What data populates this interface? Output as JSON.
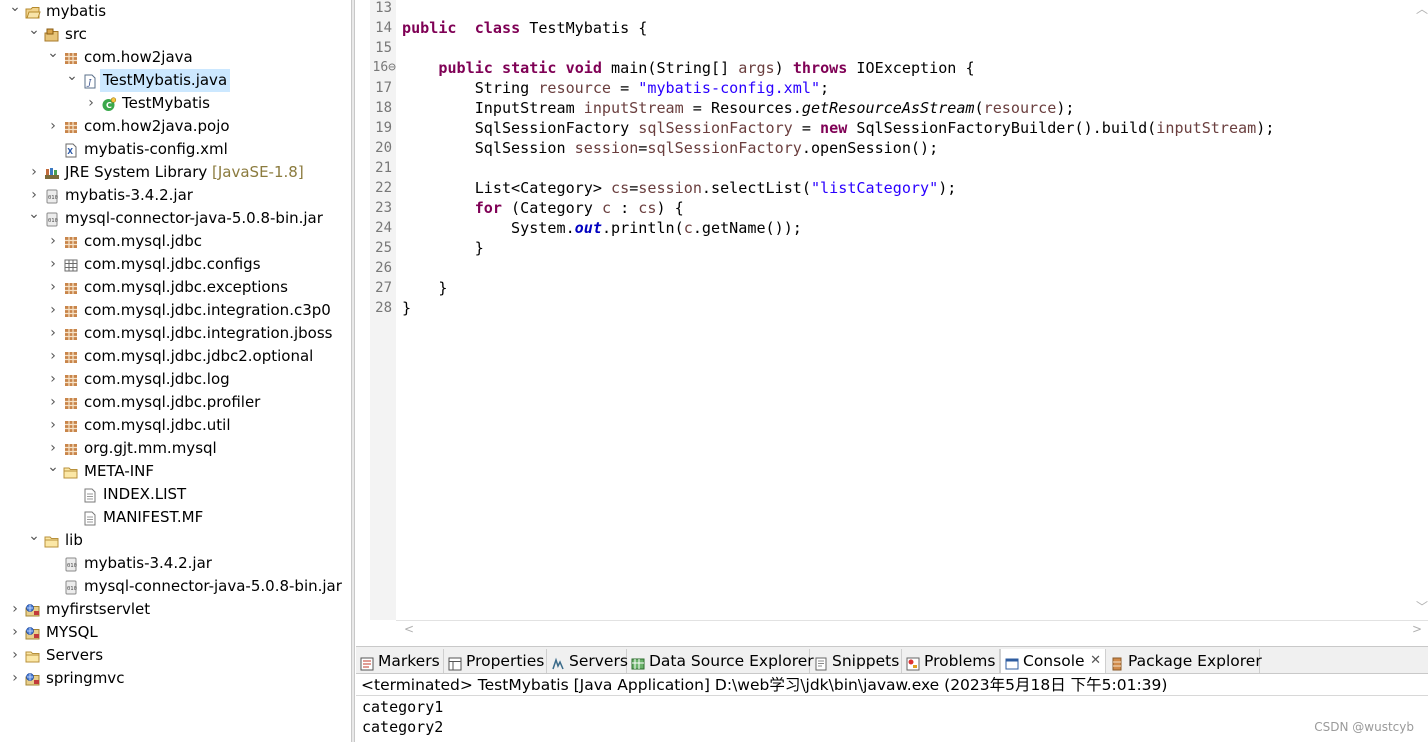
{
  "tree": {
    "items": [
      {
        "label": "mybatis",
        "icon": "project-folder-icon",
        "twisty": "expanded"
      },
      {
        "label": "src",
        "icon": "source-folder-icon",
        "twisty": "expanded"
      },
      {
        "label": "com.how2java",
        "icon": "package-icon",
        "twisty": "expanded"
      },
      {
        "label": "TestMybatis.java",
        "icon": "java-file-icon",
        "twisty": "expanded"
      },
      {
        "label": "TestMybatis",
        "icon": "class-icon",
        "twisty": "collapsed"
      },
      {
        "label": "com.how2java.pojo",
        "icon": "package-icon",
        "twisty": "collapsed"
      },
      {
        "label": "mybatis-config.xml",
        "icon": "xml-file-icon",
        "twisty": "none"
      },
      {
        "label": "JRE System Library",
        "hint": "[JavaSE-1.8]",
        "icon": "library-icon",
        "twisty": "collapsed"
      },
      {
        "label": "mybatis-3.4.2.jar",
        "icon": "jar-icon",
        "twisty": "collapsed"
      },
      {
        "label": "mysql-connector-java-5.0.8-bin.jar",
        "icon": "jar-icon",
        "twisty": "expanded"
      },
      {
        "label": "com.mysql.jdbc",
        "icon": "package-icon",
        "twisty": "collapsed"
      },
      {
        "label": "com.mysql.jdbc.configs",
        "icon": "empty-package-icon",
        "twisty": "collapsed"
      },
      {
        "label": "com.mysql.jdbc.exceptions",
        "icon": "package-icon",
        "twisty": "collapsed"
      },
      {
        "label": "com.mysql.jdbc.integration.c3p0",
        "icon": "package-icon",
        "twisty": "collapsed"
      },
      {
        "label": "com.mysql.jdbc.integration.jboss",
        "icon": "package-icon",
        "twisty": "collapsed"
      },
      {
        "label": "com.mysql.jdbc.jdbc2.optional",
        "icon": "package-icon",
        "twisty": "collapsed"
      },
      {
        "label": "com.mysql.jdbc.log",
        "icon": "package-icon",
        "twisty": "collapsed"
      },
      {
        "label": "com.mysql.jdbc.profiler",
        "icon": "package-icon",
        "twisty": "collapsed"
      },
      {
        "label": "com.mysql.jdbc.util",
        "icon": "package-icon",
        "twisty": "collapsed"
      },
      {
        "label": "org.gjt.mm.mysql",
        "icon": "package-icon",
        "twisty": "collapsed"
      },
      {
        "label": "META-INF",
        "icon": "folder-icon",
        "twisty": "expanded"
      },
      {
        "label": "INDEX.LIST",
        "icon": "text-file-icon",
        "twisty": "none"
      },
      {
        "label": "MANIFEST.MF",
        "icon": "text-file-icon",
        "twisty": "none"
      },
      {
        "label": "lib",
        "icon": "folder-icon",
        "twisty": "expanded"
      },
      {
        "label": "mybatis-3.4.2.jar",
        "icon": "jar-icon",
        "twisty": "none"
      },
      {
        "label": "mysql-connector-java-5.0.8-bin.jar",
        "icon": "jar-icon",
        "twisty": "none"
      },
      {
        "label": "myfirstservlet",
        "icon": "web-project-icon",
        "twisty": "collapsed"
      },
      {
        "label": "MYSQL",
        "icon": "web-project-icon",
        "twisty": "collapsed"
      },
      {
        "label": "Servers",
        "icon": "folder-icon",
        "twisty": "collapsed"
      },
      {
        "label": "springmvc",
        "icon": "web-project-icon",
        "twisty": "collapsed"
      }
    ]
  },
  "editor": {
    "lines": [
      {
        "n": "13"
      },
      {
        "n": "14",
        "parts": [
          [
            "kw",
            "public"
          ],
          [
            "",
            "  "
          ],
          [
            "kw",
            "class"
          ],
          [
            "",
            " TestMybatis {"
          ]
        ]
      },
      {
        "n": "15",
        "parts": []
      },
      {
        "n": "16⊖",
        "parts": [
          [
            "",
            "    "
          ],
          [
            "kw",
            "public"
          ],
          [
            "",
            ""
          ],
          [
            "kw",
            " static"
          ],
          [
            "kw",
            " void"
          ],
          [
            "",
            " main(String[] "
          ],
          [
            "fld",
            "args"
          ],
          [
            "",
            ") "
          ],
          [
            "kw",
            "throws"
          ],
          [
            "",
            " IOException {"
          ]
        ]
      },
      {
        "n": "17",
        "parts": [
          [
            "",
            "        String "
          ],
          [
            "fld",
            "resource"
          ],
          [
            "",
            " = "
          ],
          [
            "str",
            "\"mybatis-config.xml\""
          ],
          [
            "",
            ";"
          ]
        ]
      },
      {
        "n": "18",
        "parts": [
          [
            "",
            "        InputStream "
          ],
          [
            "fld",
            "inputStream"
          ],
          [
            "",
            " = Resources."
          ],
          [
            "it",
            "getResourceAsStream"
          ],
          [
            "",
            "("
          ],
          [
            "fld",
            "resource"
          ],
          [
            "",
            ");"
          ]
        ]
      },
      {
        "n": "19",
        "parts": [
          [
            "",
            "        SqlSessionFactory "
          ],
          [
            "fld",
            "sqlSessionFactory"
          ],
          [
            "",
            " = "
          ],
          [
            "kw",
            "new"
          ],
          [
            "",
            " SqlSessionFactoryBuilder().build("
          ],
          [
            "fld",
            "inputStream"
          ],
          [
            "",
            ");"
          ]
        ]
      },
      {
        "n": "20",
        "parts": [
          [
            "",
            "        SqlSession "
          ],
          [
            "fld",
            "session"
          ],
          [
            "",
            "="
          ],
          [
            "fld",
            "sqlSessionFactory"
          ],
          [
            "",
            ".openSession();"
          ]
        ]
      },
      {
        "n": "21",
        "parts": []
      },
      {
        "n": "22",
        "parts": [
          [
            "",
            "        List<Category> "
          ],
          [
            "fld",
            "cs"
          ],
          [
            "",
            "="
          ],
          [
            "fld",
            "session"
          ],
          [
            "",
            ".selectList("
          ],
          [
            "str",
            "\"listCategory\""
          ],
          [
            "",
            ");"
          ]
        ]
      },
      {
        "n": "23",
        "parts": [
          [
            "",
            "        "
          ],
          [
            "kw",
            "for"
          ],
          [
            "",
            " (Category "
          ],
          [
            "fld",
            "c"
          ],
          [
            "",
            " : "
          ],
          [
            "fld",
            "cs"
          ],
          [
            "",
            ") {"
          ]
        ]
      },
      {
        "n": "24",
        "parts": [
          [
            "",
            "            System."
          ],
          [
            "sfld",
            "out"
          ],
          [
            "",
            ".println("
          ],
          [
            "fld",
            "c"
          ],
          [
            "",
            ".getName());"
          ]
        ]
      },
      {
        "n": "25",
        "parts": [
          [
            "",
            "        }"
          ]
        ]
      },
      {
        "n": "26",
        "parts": []
      },
      {
        "n": "27",
        "parts": [
          [
            "",
            "    }"
          ]
        ]
      },
      {
        "n": "28",
        "parts": [
          [
            "",
            "}"
          ]
        ]
      }
    ]
  },
  "panel": {
    "tabs": [
      {
        "label": "Markers",
        "icon": "markers-icon"
      },
      {
        "label": "Properties",
        "icon": "properties-icon"
      },
      {
        "label": "Servers",
        "icon": "servers-icon"
      },
      {
        "label": "Data Source Explorer",
        "icon": "data-source-icon"
      },
      {
        "label": "Snippets",
        "icon": "snippets-icon"
      },
      {
        "label": "Problems",
        "icon": "problems-icon"
      },
      {
        "label": "Console",
        "icon": "console-icon",
        "active": true,
        "close": "✕"
      },
      {
        "label": "Package Explorer",
        "icon": "package-explorer-icon"
      }
    ],
    "terminated": "<terminated> TestMybatis [Java Application] D:\\web学习\\jdk\\bin\\javaw.exe (2023年5月18日 下午5:01:39)",
    "output": [
      "category1",
      "category2"
    ]
  },
  "watermark": "CSDN @wustcyb"
}
